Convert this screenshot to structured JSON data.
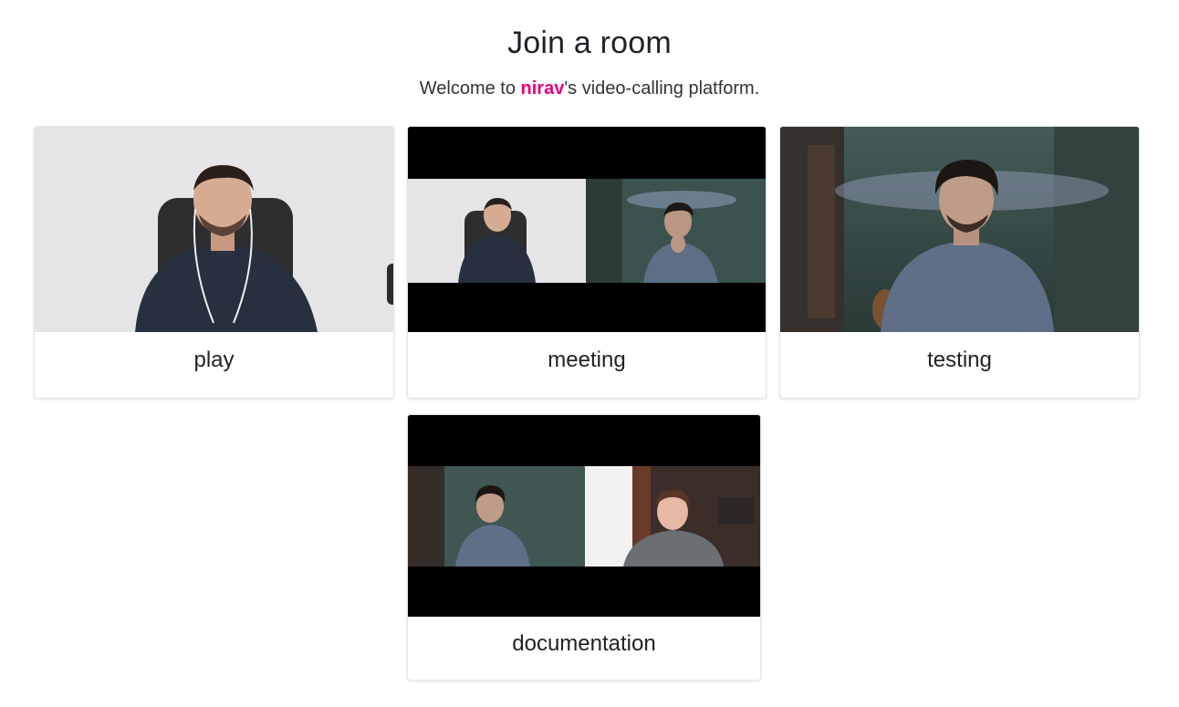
{
  "header": {
    "title": "Join a room",
    "subtitle_prefix": "Welcome to ",
    "owner": "nirav",
    "subtitle_suffix": "'s video-calling platform."
  },
  "rooms": [
    {
      "name": "play"
    },
    {
      "name": "meeting"
    },
    {
      "name": "testing"
    },
    {
      "name": "documentation"
    }
  ],
  "colors": {
    "accent": "#e6007a",
    "text": "#212529",
    "card_border": "#e2e4e7"
  }
}
